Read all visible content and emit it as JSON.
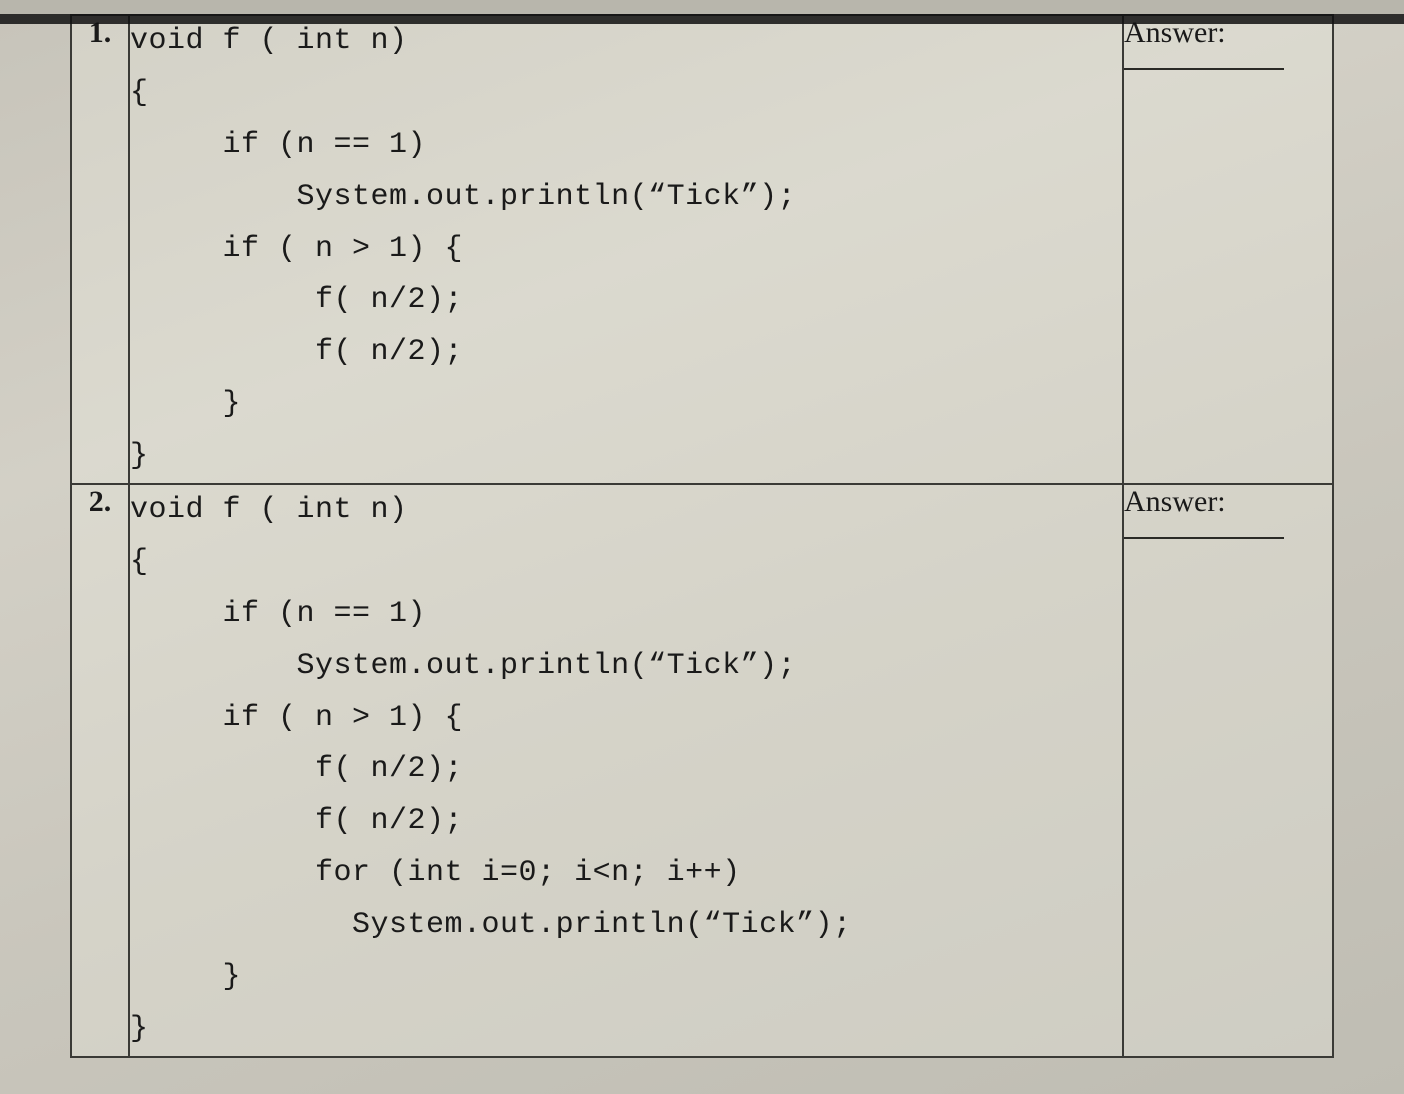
{
  "rows": [
    {
      "num": "1.",
      "code": "void f ( int n)\n{\n     if (n == 1)\n         System.out.println(“Tick”);\n     if ( n > 1) {\n          f( n/2);\n          f( n/2);\n     }\n}",
      "answer_label": "Answer:"
    },
    {
      "num": "2.",
      "code": "void f ( int n)\n{\n     if (n == 1)\n         System.out.println(“Tick”);\n     if ( n > 1) {\n          f( n/2);\n          f( n/2);\n          for (int i=0; i<n; i++)\n            System.out.println(“Tick”);\n     }\n}",
      "answer_label": "Answer:"
    }
  ]
}
